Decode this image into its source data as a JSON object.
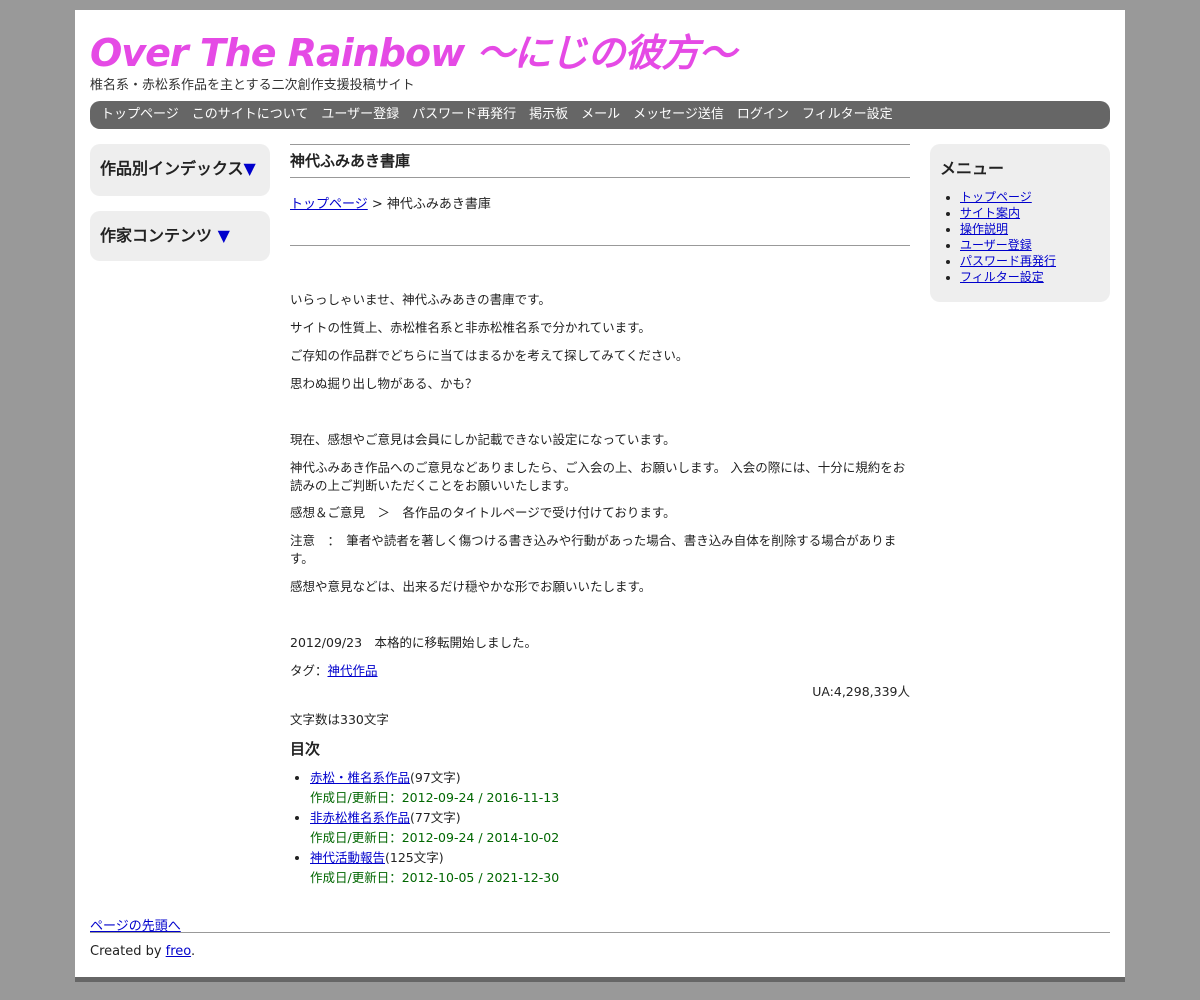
{
  "site": {
    "title": "Over The Rainbow ～にじの彼方～",
    "description": "椎名系・赤松系作品を主とする二次創作支援投稿サイト"
  },
  "nav": [
    "トップページ",
    "このサイトについて",
    "ユーザー登録",
    "パスワード再発行",
    "掲示板",
    "メール",
    "メッセージ送信",
    "ログイン",
    "フィルター設定"
  ],
  "left": {
    "index_title": "作品別インデックス",
    "index_toggle": "▼",
    "author_title": "作家コンテンツ ",
    "author_toggle": "▼"
  },
  "menu": {
    "title": "メニュー",
    "items": [
      "トップページ",
      "サイト案内",
      "操作説明",
      "ユーザー登録",
      "パスワード再発行",
      "フィルター設定"
    ]
  },
  "main": {
    "title": "神代ふみあき書庫",
    "breadcrumb": {
      "home": "トップページ",
      "sep": " > ",
      "current": "神代ふみあき書庫"
    },
    "paragraphs": [
      "いらっしゃいませ、神代ふみあきの書庫です。",
      "サイトの性質上、赤松椎名系と非赤松椎名系で分かれています。",
      "ご存知の作品群でどちらに当てはまるかを考えて探してみてください。",
      "思わぬ掘り出し物がある、かも？",
      "現在、感想やご意見は会員にしか記載できない設定になっています。",
      "神代ふみあき作品へのご意見などありましたら、ご入会の上、お願いします。 入会の際には、十分に規約をお読みの上ご判断いただくことをお願いいたします。",
      "感想＆ご意見　＞　各作品のタイトルページで受け付けております。",
      "注意　：　筆者や読者を著しく傷つける書き込みや行動があった場合、書き込み自体を削除する場合があります。",
      "感想や意見などは、出来るだけ穏やかな形でお願いいたします。",
      " 2012/09/23　本格的に移転開始しました。"
    ],
    "tag_label": "タグ：",
    "tag": "神代作品",
    "ua": "UA:4,298,339人",
    "char_count": "文字数は330文字",
    "toc_title": "目次",
    "toc": [
      {
        "title": "赤松・椎名系作品",
        "count": "(97文字)",
        "dates": "作成日/更新日：2012-09-24 / 2016-11-13"
      },
      {
        "title": "非赤松椎名系作品",
        "count": "(77文字)",
        "dates": "作成日/更新日：2012-09-24 / 2014-10-02"
      },
      {
        "title": "神代活動報告",
        "count": "(125文字)",
        "dates": "作成日/更新日：2012-10-05 / 2021-12-30"
      }
    ]
  },
  "footer": {
    "to_top": "ページの先頭へ",
    "credit_prefix": "Created by ",
    "credit_link": "freo",
    "credit_suffix": "."
  },
  "colors": {
    "title": "#e54ae5",
    "link": "#0000cc",
    "date": "#006600",
    "nav_bg": "#666666",
    "side_bg": "#eeeeee",
    "page_bg": "#999999"
  }
}
